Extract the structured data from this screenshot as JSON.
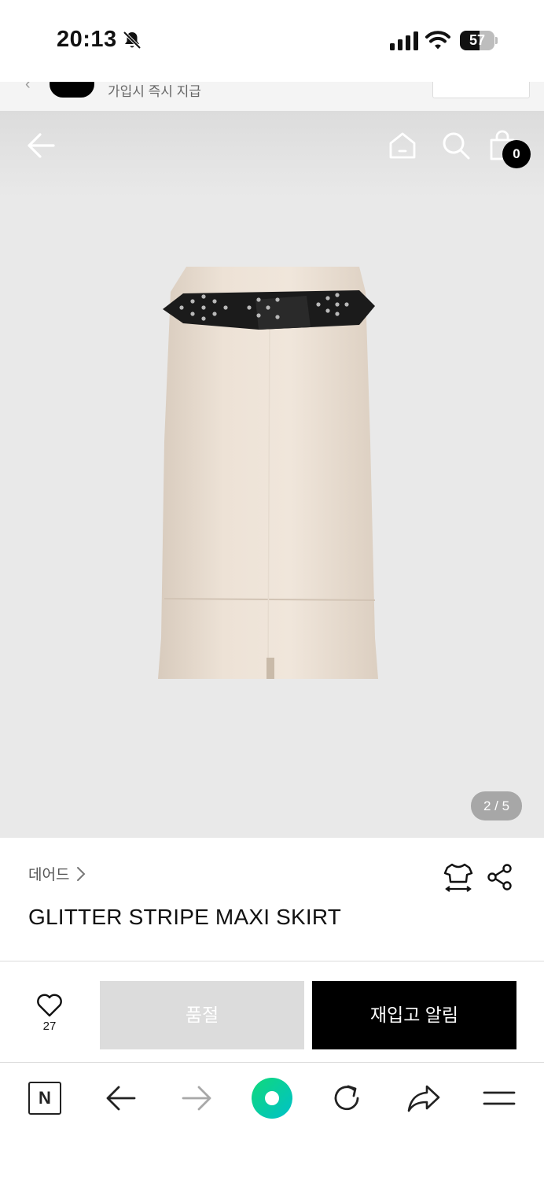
{
  "status_bar": {
    "time": "20:13",
    "battery_level": 57,
    "battery_text": "57"
  },
  "promo": {
    "text": "가입시 즉시 지급"
  },
  "header": {
    "cart_count": "0"
  },
  "gallery": {
    "page_indicator": "2 / 5",
    "current_image": 2,
    "total_images": 5
  },
  "product": {
    "brand": "데어드",
    "title": "GLITTER STRIPE MAXI SKIRT"
  },
  "purchase_bar": {
    "like_count": "27",
    "soldout_label": "품절",
    "restock_label": "재입고 알림"
  },
  "browser_toolbar": {
    "naver_label": "N"
  },
  "colors": {
    "hero_bg": "#e9e9e9",
    "primary": "#000000",
    "disabled": "#dcdcdc",
    "accent_green": "#19ce60"
  },
  "icons": [
    "bell-off-icon",
    "signal-icon",
    "wifi-icon",
    "battery-icon",
    "back-arrow-icon",
    "home-icon",
    "search-icon",
    "cart-icon",
    "chevron-right-icon",
    "size-fit-icon",
    "share-icon",
    "heart-icon",
    "naver-icon",
    "browser-back-icon",
    "browser-forward-icon",
    "naver-home-icon",
    "reload-icon",
    "browser-share-icon",
    "menu-icon"
  ]
}
